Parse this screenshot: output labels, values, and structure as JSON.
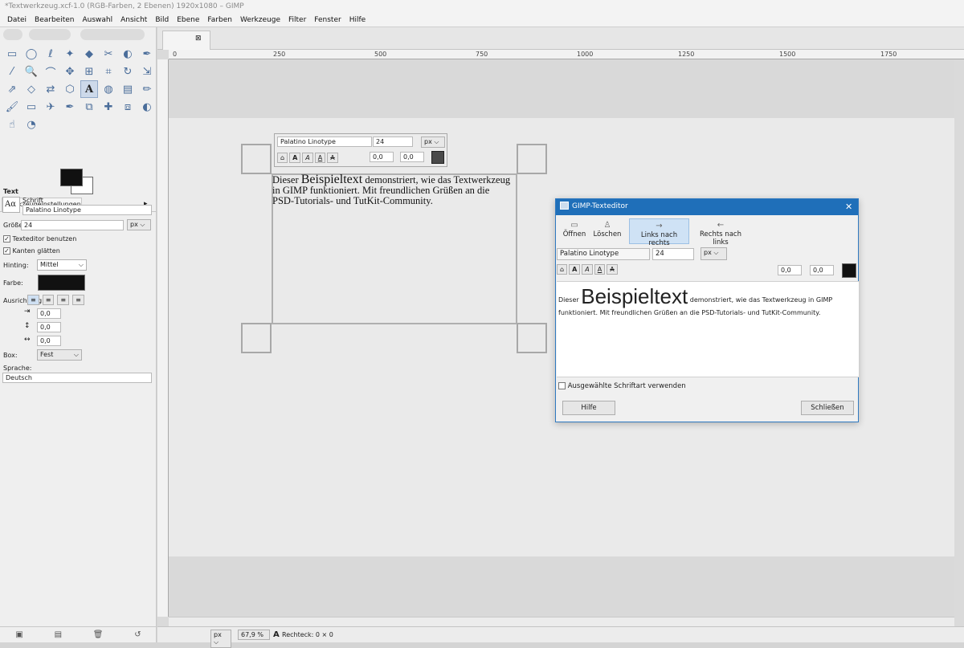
{
  "window": {
    "title": "*Textwerkzeug.xcf-1.0 (RGB-Farben, 2 Ebenen) 1920x1080 – GIMP"
  },
  "menu": [
    "Datei",
    "Bearbeiten",
    "Auswahl",
    "Ansicht",
    "Bild",
    "Ebene",
    "Farben",
    "Werkzeuge",
    "Filter",
    "Fenster",
    "Hilfe"
  ],
  "toolbox": {
    "tools": [
      "rect-select-icon",
      "ellipse-select-icon",
      "lasso-icon",
      "fuzzy-select-icon",
      "color-select-icon",
      "scissors-icon",
      "foreground-select-icon",
      "paths-icon",
      "color-picker-icon",
      "zoom-icon",
      "measure-icon",
      "move-icon",
      "align-icon",
      "crop-icon",
      "rotate-icon",
      "scale-icon",
      "shear-icon",
      "perspective-icon",
      "flip-icon",
      "cage-icon",
      "text-icon",
      "bucket-fill-icon",
      "blend-icon",
      "pencil-icon",
      "paintbrush-icon",
      "eraser-icon",
      "airbrush-icon",
      "ink-icon",
      "clone-icon",
      "heal-icon",
      "perspective-clone-icon",
      "blur-icon",
      "smudge-icon",
      "dodge-burn-icon"
    ],
    "tool_glyphs": [
      "▭",
      "◯",
      "ℓ",
      "✦",
      "◆",
      "✂",
      "◐",
      "✒",
      "⁄",
      "🔍",
      "⌒",
      "✥",
      "⊞",
      "⌗",
      "↻",
      "⇲",
      "⇗",
      "◇",
      "⇄",
      "⬡",
      "A",
      "◍",
      "▤",
      "✏",
      "🖌",
      "▭",
      "✈",
      "✒",
      "⧉",
      "✚",
      "⧈",
      "◐",
      "☝",
      "◔"
    ],
    "tab_label": "Werkzeugeinstellungen",
    "section_title": "Text",
    "font_label": "Schrift",
    "font_value": "Palatino Linotype",
    "font_preview": "Aα",
    "size_label": "Größe:",
    "size_value": "24",
    "unit_value": "px",
    "use_editor_label": "Texteditor benutzen",
    "antialias_label": "Kanten glätten",
    "hinting_label": "Hinting:",
    "hinting_value": "Mittel",
    "color_label": "Farbe:",
    "justify_label": "Ausrichtung:",
    "indent_value": "0,0",
    "line_spacing_value": "0,0",
    "letter_spacing_value": "0,0",
    "box_label": "Box:",
    "box_value": "Fest",
    "language_label": "Sprache:",
    "language_value": "Deutsch"
  },
  "ruler": {
    "marks": [
      "0",
      "250",
      "500",
      "750",
      "1000",
      "1250",
      "1500",
      "1750"
    ]
  },
  "floating_bar": {
    "font": "Palatino Linotype",
    "size": "24",
    "unit": "px",
    "baseline": "0,0",
    "kerning": "0,0"
  },
  "canvas_text": {
    "prefix": "Dieser ",
    "big": "Beispieltext",
    "rest": " demonstriert, wie das Textwerkzeug in GIMP funktioniert. Mit freundlichen Grüßen an die PSD-Tutorials- und TutKit-Community."
  },
  "status": {
    "unit": "px",
    "zoom": "67,9 %",
    "info": "Rechteck: 0 × 0"
  },
  "dialog": {
    "title": "GIMP-Texteditor",
    "open": "Öffnen",
    "clear": "Löschen",
    "ltr": "Links nach rechts",
    "rtl": "Rechts nach links",
    "font": "Palatino Linotype",
    "size": "24",
    "unit": "px",
    "baseline": "0,0",
    "kerning": "0,0",
    "text_prefix": "Dieser ",
    "text_big": "Beispieltext",
    "text_rest": " demonstriert, wie das Textwerkzeug in GIMP funktioniert. Mit freundlichen Grüßen an die PSD-Tutorials- und TutKit-Community.",
    "use_font_label": "Ausgewählte Schriftart verwenden",
    "help": "Hilfe",
    "close": "Schließen"
  }
}
